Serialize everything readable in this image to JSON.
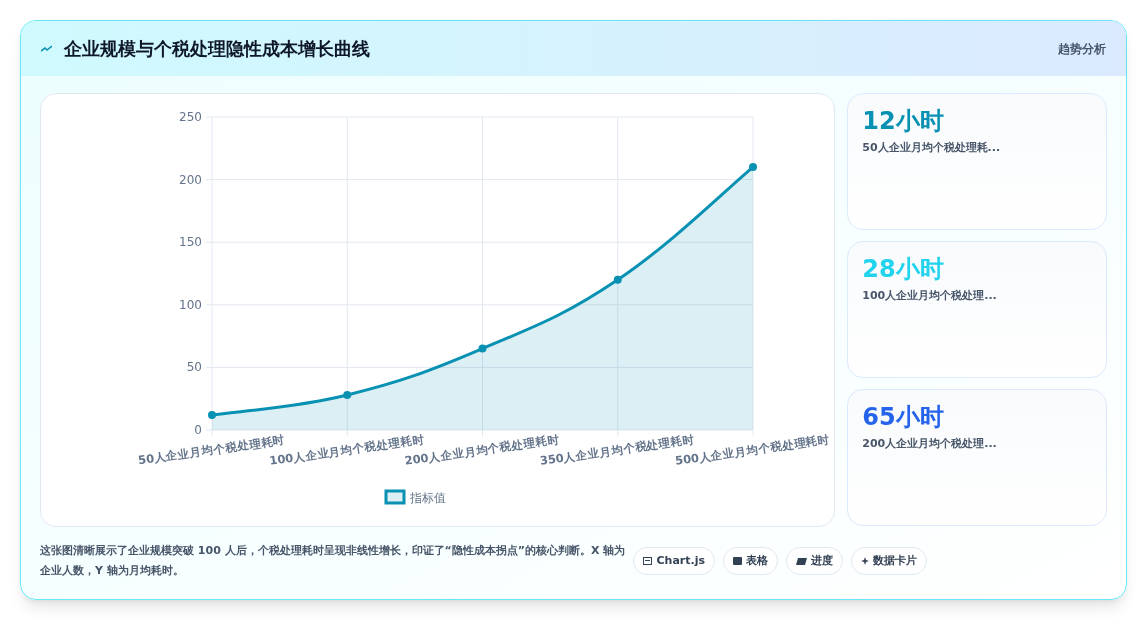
{
  "header": {
    "title": "企业规模与个税处理隐性成本增长曲线",
    "badge": "趋势分析"
  },
  "chart": {
    "chart_data": {
      "type": "area",
      "categories": [
        "50人企业月均个税处理耗时",
        "100人企业月均个税处理耗时",
        "200人企业月均个税处理耗时",
        "350人企业月均个税处理耗时",
        "500人企业月均个税处理耗时"
      ],
      "ylim": [
        0,
        250
      ],
      "grid": true,
      "yticks": [
        0,
        50,
        100,
        150,
        200,
        250
      ],
      "series": [
        {
          "name": "指标值",
          "color": "#0891b2",
          "values": [
            12,
            28,
            65,
            120,
            210
          ]
        }
      ]
    }
  },
  "stat_cards": [
    {
      "value": "12小时",
      "label": "50人企业月均个税处理耗...",
      "color": "#0891b2"
    },
    {
      "value": "28小时",
      "label": "100人企业月均个税处理...",
      "color": "#22d3ee"
    },
    {
      "value": "65小时",
      "label": "200人企业月均个税处理...",
      "color": "#2563eb"
    }
  ],
  "footer": {
    "note": "这张图清晰展示了企业规模突破 100 人后，个税处理耗时呈现非线性增长，印证了“隐性成本拐点”的核心判断。X 轴为企业人数，Y 轴为月均耗时。",
    "chips": [
      "Chart.js",
      "表格",
      "进度",
      "数据卡片"
    ]
  }
}
